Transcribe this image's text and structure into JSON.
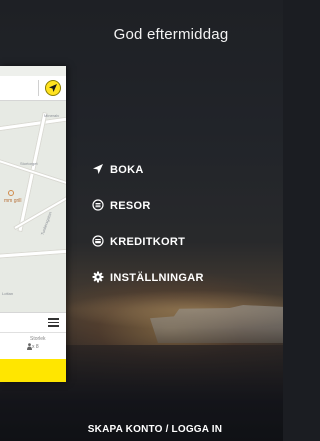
{
  "greeting": "God eftermiddag",
  "map_preview": {
    "poi_label": "mm grill",
    "small_labels": [
      "Mineralv",
      "Tunkersgatan",
      "Stortorget",
      "Lottan"
    ],
    "size_label": "Storlek",
    "size_count": "x 8"
  },
  "menu": {
    "items": [
      {
        "label": "BOKA",
        "icon": "location-arrow-icon"
      },
      {
        "label": "RESOR",
        "icon": "list-icon"
      },
      {
        "label": "KREDITKORT",
        "icon": "card-icon"
      },
      {
        "label": "INSTÄLLNINGAR",
        "icon": "gear-icon"
      }
    ]
  },
  "footer": {
    "account_link": "SKAPA KONTO / LOGGA IN"
  },
  "colors": {
    "accent": "#ffe600",
    "text": "#ffffff"
  }
}
